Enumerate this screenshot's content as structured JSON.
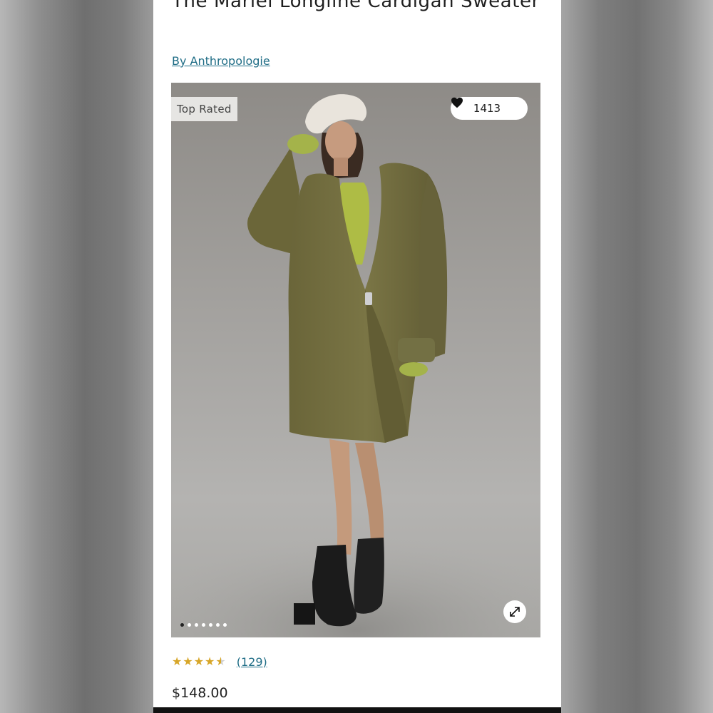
{
  "product": {
    "title": "The Mariel Longline Cardigan Sweater",
    "brand_link": "By Anthropologie",
    "badge": "Top Rated",
    "likes_count": "1413",
    "rating": 4.5,
    "stars_text": "★★★★★",
    "reviews_link": "(129)",
    "price": "$148.00"
  },
  "gallery": {
    "image_count": 7,
    "active_index": 0
  },
  "icons": {
    "like": "heart-icon",
    "expand": "expand-icon"
  },
  "colors": {
    "link": "#1f6d86",
    "stars": "#d7a628",
    "cardigan": "#6e6a3e",
    "sweater": "#b5c24a"
  }
}
